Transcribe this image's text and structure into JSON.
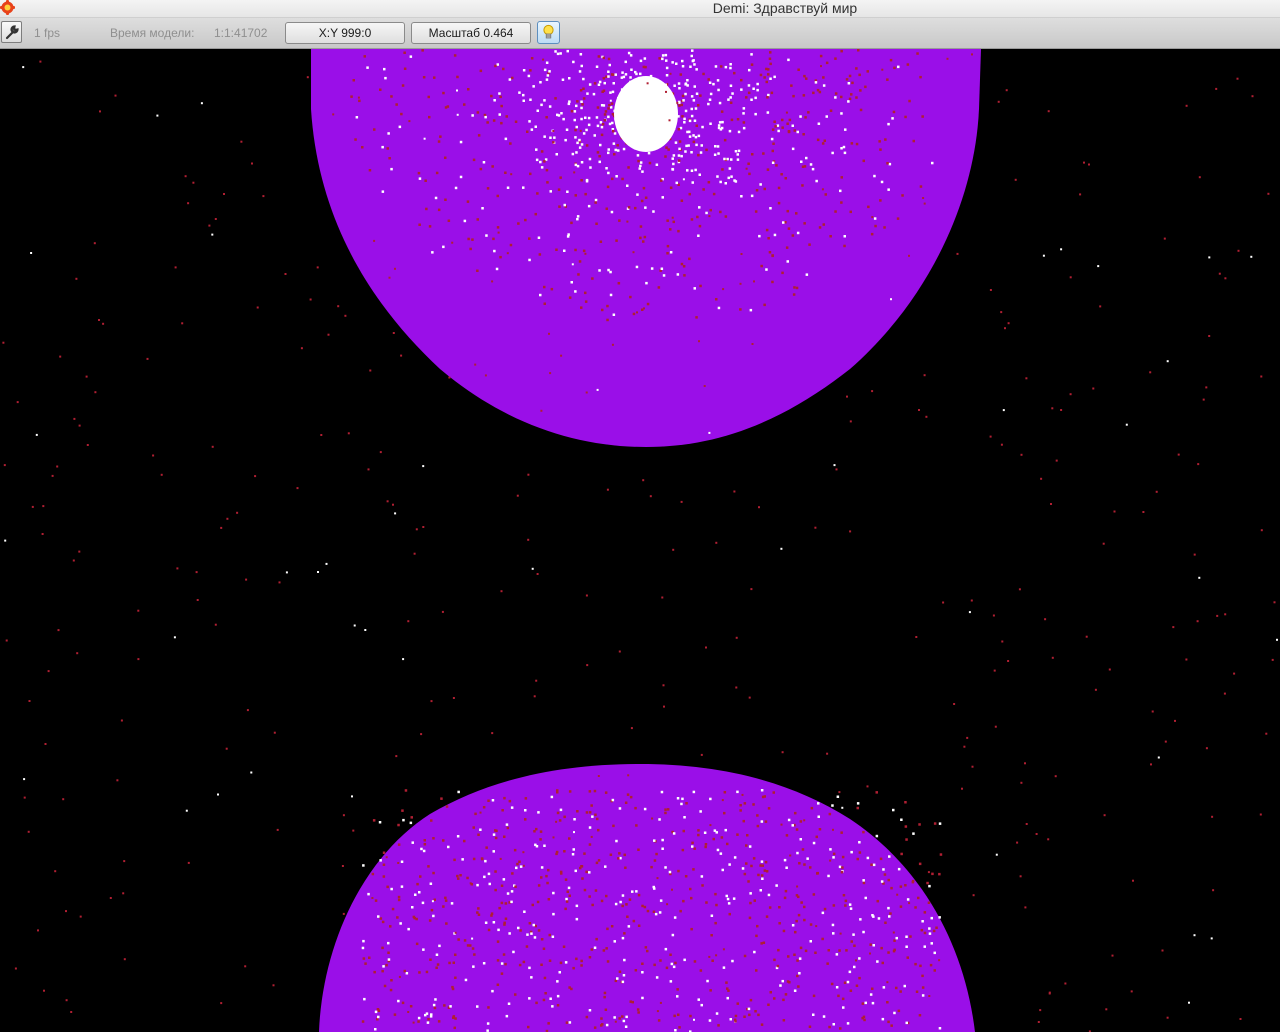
{
  "window": {
    "title": "Demi: Здравствуй мир"
  },
  "toolbar": {
    "fps": "1 fps",
    "model_time_label": "Время модели:",
    "model_time_value": "1:1:41702",
    "xy_button": "X:Y 999:0",
    "scale_button": "Масштаб 0.464"
  },
  "icons": {
    "app": "gear-flower-icon",
    "settings": "wrench-icon",
    "light": "lightbulb-icon"
  },
  "colors": {
    "sphere": "#9a0fe8",
    "particle_red": "#b01f32",
    "particle_white": "#ffffff",
    "background": "#000000"
  }
}
